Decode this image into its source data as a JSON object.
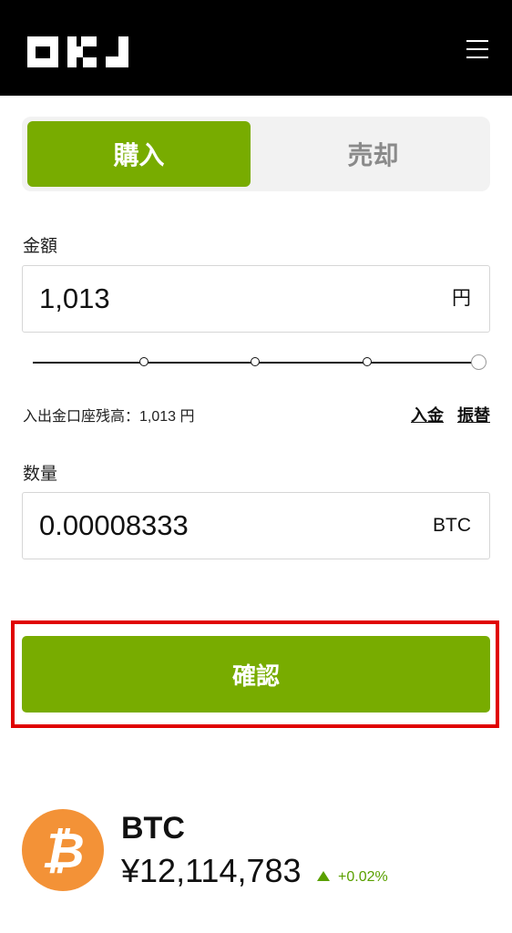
{
  "header": {
    "logo_text": "OKJ"
  },
  "tabs": [
    {
      "label": "購入",
      "active": true
    },
    {
      "label": "売却",
      "active": false
    }
  ],
  "amount": {
    "label": "金額",
    "value": "1,013",
    "unit": "円"
  },
  "slider": {
    "stops": [
      0,
      25,
      50,
      75,
      100
    ],
    "level_percent": 100
  },
  "balance": {
    "text": "入出金口座残高：1,013 円"
  },
  "links": {
    "deposit": "入金",
    "transfer": "振替"
  },
  "quantity": {
    "label": "数量",
    "value": "0.00008333",
    "unit": "BTC"
  },
  "confirm": {
    "label": "確認"
  },
  "coin": {
    "icon": "bitcoin-icon",
    "symbol_glyph": "₿",
    "name": "BTC",
    "price": "¥12,114,783",
    "change": "+0.02%",
    "change_direction": "up"
  },
  "colors": {
    "accent_green": "#78ac00",
    "highlight_red": "#e00000",
    "header_bg": "#000000",
    "bitcoin_orange": "#f39237",
    "change_up": "#5aa000"
  }
}
